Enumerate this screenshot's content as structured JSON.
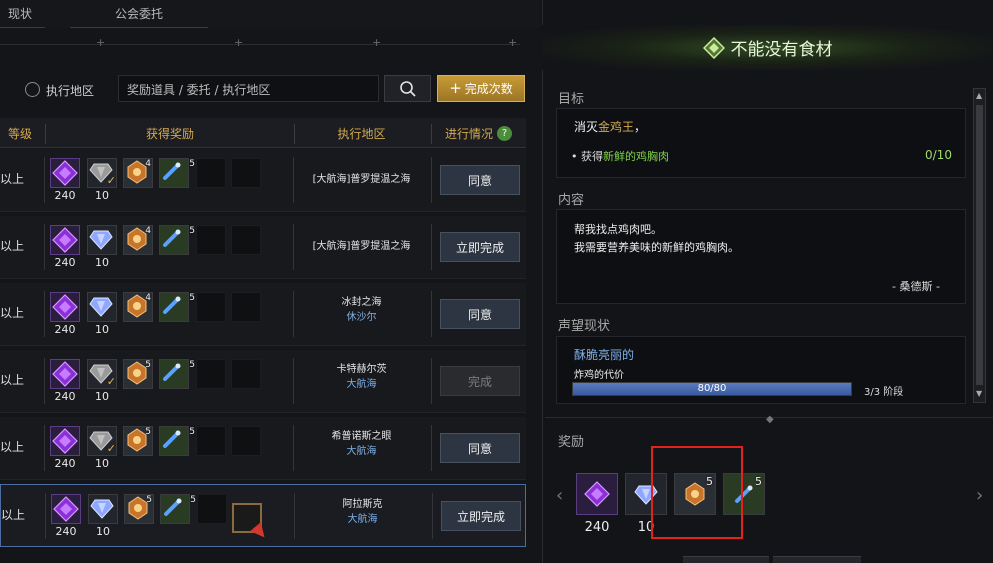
{
  "tabs": [
    {
      "label": "现状"
    },
    {
      "label": "公会委托"
    }
  ],
  "filter": {
    "radio_label": "执行地区",
    "search_placeholder": "奖励道具 / 委托 / 执行地区",
    "complete_count_label": "完成次数"
  },
  "table": {
    "headers": {
      "level": "等级",
      "rewards": "获得奖励",
      "region": "执行地区",
      "status": "进行情况"
    },
    "rows": [
      {
        "level": "以上",
        "r1": "240",
        "r2": "10",
        "r3c": "4",
        "r4c": "5",
        "region": "[大航海]普罗提温之海",
        "sub": "",
        "action": "同意"
      },
      {
        "level": "以上",
        "r1": "240",
        "r2": "10",
        "r3c": "4",
        "r4c": "5",
        "region": "[大航海]普罗提温之海",
        "sub": "",
        "action": "立即完成"
      },
      {
        "level": "以上",
        "r1": "240",
        "r2": "10",
        "r3c": "4",
        "r4c": "5",
        "region": "冰封之海",
        "sub": "休沙尔",
        "action": "同意"
      },
      {
        "level": "以上",
        "r1": "240",
        "r2": "10",
        "r3c": "5",
        "r4c": "5",
        "region": "卡特赫尔茨",
        "sub": "大航海",
        "action": "完成"
      },
      {
        "level": "以上",
        "r1": "240",
        "r2": "10",
        "r3c": "5",
        "r4c": "5",
        "region": "希普诺斯之眼",
        "sub": "大航海",
        "action": "同意"
      },
      {
        "level": "以上",
        "r1": "240",
        "r2": "10",
        "r3c": "5",
        "r4c": "5",
        "region": "阿拉斯克",
        "sub": "大航海",
        "action": "立即完成"
      }
    ]
  },
  "quest": {
    "title": "不能没有食材",
    "goal_header": "目标",
    "goal_pre": "消灭",
    "goal_target": "金鸡王",
    "goal_post": "，",
    "sub_pre": "• 获得",
    "sub_item": "新鲜的鸡胸肉",
    "sub_progress": "0/10",
    "content_header": "内容",
    "content_line1": "帮我找点鸡肉吧。",
    "content_line2": "我需要营养美味的新鲜的鸡胸肉。",
    "signature": "- 桑德斯 -",
    "rep_header": "声望现状",
    "rep_name": "酥脆亮丽的",
    "rep_sub": "炸鸡的代价",
    "rep_bar": "80/80",
    "rep_progress": 1.0,
    "rep_stage": "3/3 阶段",
    "reward_header": "奖励",
    "reward_amt1": "240",
    "reward_amt2": "10",
    "reward_c3": "5",
    "reward_c4": "5"
  },
  "colors": {
    "gold": "#d2a94f",
    "green": "#7fd34a",
    "blue": "#7fb0e8",
    "highlight": "#e3221c"
  }
}
